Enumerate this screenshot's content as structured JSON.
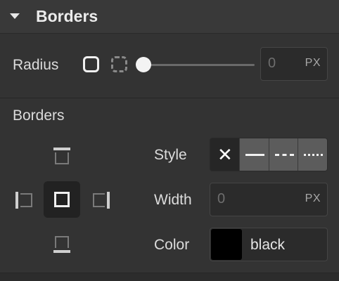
{
  "header": {
    "title": "Borders",
    "caret_icon": "caret-down-icon"
  },
  "radius": {
    "label": "Radius",
    "icons": [
      "all-corners-icon",
      "individual-corners-icon"
    ],
    "slider_value": 0,
    "value": "0",
    "unit": "PX"
  },
  "borders": {
    "label": "Borders",
    "sides": [
      "top",
      "left",
      "all",
      "right",
      "bottom"
    ],
    "selected_side": "all",
    "style": {
      "label": "Style",
      "options": [
        "none",
        "solid",
        "dashed",
        "dotted"
      ],
      "selected": "none"
    },
    "width": {
      "label": "Width",
      "placeholder": "0",
      "unit": "PX"
    },
    "color": {
      "label": "Color",
      "value": "black",
      "swatch": "#000000"
    }
  },
  "colors": {
    "panel_bg": "#333333",
    "header_bg": "#393939",
    "input_bg": "#2b2b2b",
    "selected_bg": "#222222",
    "style_button_bg": "#5c5c5c"
  }
}
